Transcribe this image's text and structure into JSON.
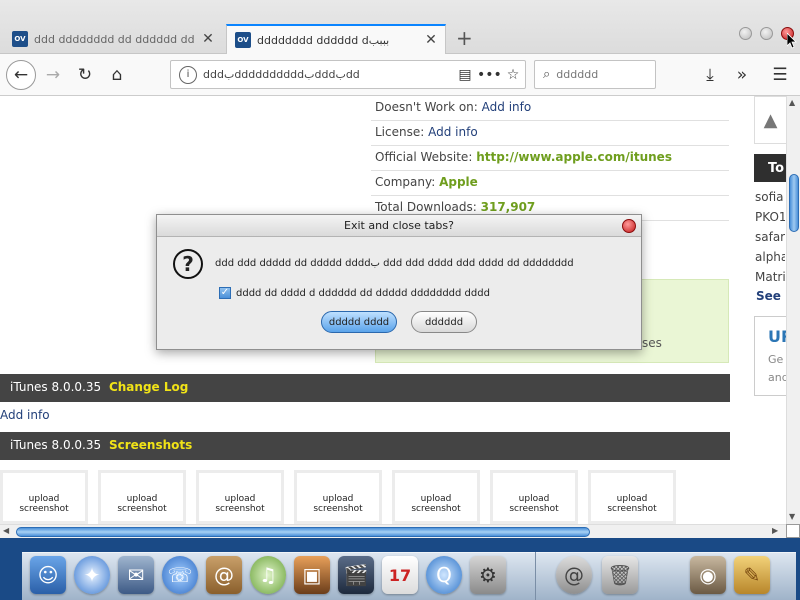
{
  "tabs": [
    {
      "favicon": "OV",
      "title": "ddd dddddddd dd dddddd dd"
    },
    {
      "favicon": "OV",
      "title": "dddddddd dddddd dبببب"
    }
  ],
  "address_bar": {
    "url": "dddبddddddddddبdddبdd"
  },
  "search_bar": {
    "placeholder": "dddddd"
  },
  "app_info": {
    "doesnt_work_label": "Doesn't Work on:",
    "doesnt_work_value": "Add info",
    "license_label": "License:",
    "license_value": "Add info",
    "website_label": "Official Website:",
    "website_value": "http://www.apple.com/itunes",
    "company_label": "Company:",
    "company_value": "Apple",
    "downloads_label": "Total Downloads:",
    "downloads_value": "317,907",
    "green_box_tail": "ses"
  },
  "right_column": {
    "top_heading": "To",
    "links": [
      "sofia",
      "PKO1",
      "safar",
      "alpha",
      "Matrix"
    ],
    "see_more": "See M",
    "promo_title": "UR",
    "promo_lines": [
      "Ge",
      "and"
    ]
  },
  "sections": [
    {
      "prefix": "iTunes 8.0.0.35",
      "highlight": "Change Log"
    },
    {
      "prefix": "iTunes 8.0.0.35",
      "highlight": "Screenshots"
    }
  ],
  "changelog_add_info": "Add info",
  "screenshots": [
    "upload screenshot",
    "upload screenshot",
    "upload screenshot",
    "upload screenshot",
    "upload screenshot",
    "upload screenshot",
    "upload screenshot"
  ],
  "dialog": {
    "title": "Exit and close tabs?",
    "message": "ddd ddd ddddd dd ddddd    ddddب ddd ddd dddd ddd dddd dd dddddddd",
    "checkbox_label": "dddd dd dddd d dddddd dd ddddd dddddddd dddd",
    "primary_button": "ddddd dddd",
    "secondary_button": "dddddd"
  },
  "colors": {
    "accent_blue": "#0a84ff",
    "link_blue": "#23407a",
    "green_link": "#6f9e1e",
    "section_bar": "#444444",
    "section_highlight": "#f1e317"
  }
}
